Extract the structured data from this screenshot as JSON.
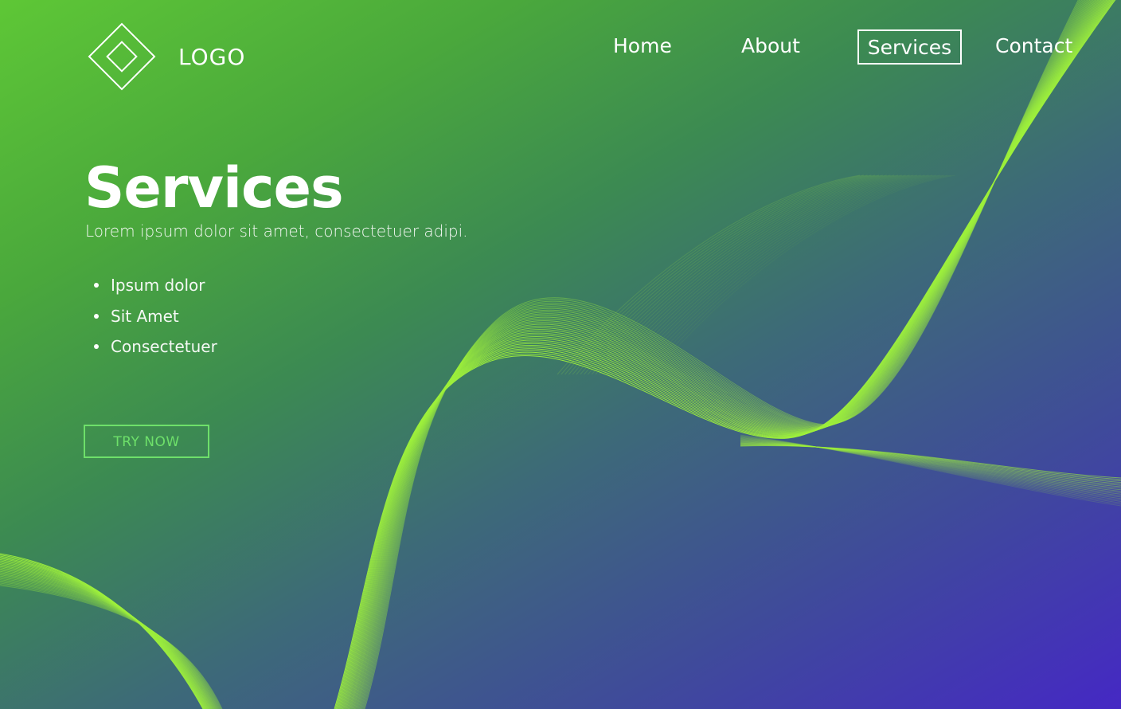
{
  "brand": {
    "logo_text": "LOGO"
  },
  "nav": {
    "items": [
      {
        "label": "Home",
        "active": false
      },
      {
        "label": "About",
        "active": false
      },
      {
        "label": "Services",
        "active": true
      },
      {
        "label": "Contact",
        "active": false
      }
    ]
  },
  "hero": {
    "title": "Services",
    "subtitle": "Lorem ipsum dolor sit amet, consectetuer adipi.",
    "features": [
      "Ipsum dolor",
      "Sit Amet",
      "Consectetuer"
    ],
    "cta_label": "TRY NOW"
  },
  "theme": {
    "gradient_start": "#5ec736",
    "gradient_end": "#4528c4",
    "wave_color": "#9ef03c",
    "cta_color": "#6ee06a"
  },
  "icons": {
    "logo": "diamond-logo-icon",
    "bullet": "bullet-dot-icon"
  }
}
